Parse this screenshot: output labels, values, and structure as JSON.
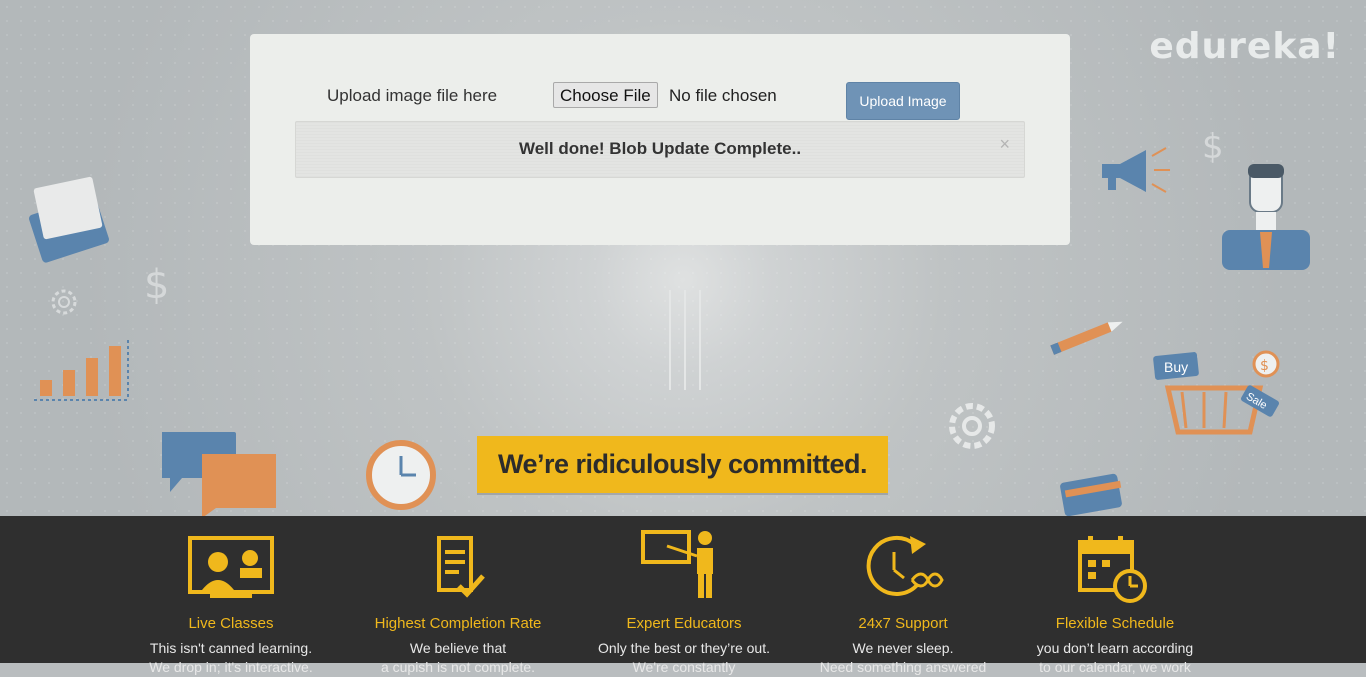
{
  "brand": "edureka!",
  "upload": {
    "label": "Upload image file here",
    "choose_button": "Choose File",
    "file_status": "No file chosen",
    "submit_button": "Upload Image"
  },
  "alert": {
    "message": "Well done! Blob Update Complete..",
    "close": "×"
  },
  "banner": "We’re ridiculously committed.",
  "decor": {
    "buy_tag": "Buy",
    "sale_tag": "Sale",
    "dollar": "$"
  },
  "features": [
    {
      "icon": "live-classes-icon",
      "title": "Live Classes",
      "desc1": "This isn't canned learning.",
      "desc2": "We drop in; it's interactive."
    },
    {
      "icon": "completion-rate-icon",
      "title": "Highest Completion Rate",
      "desc1": "We believe that",
      "desc2": "a cupish is not complete."
    },
    {
      "icon": "expert-educators-icon",
      "title": "Expert Educators",
      "desc1": "Only the best or they’re out.",
      "desc2": "We're constantly"
    },
    {
      "icon": "support-icon",
      "title": "24x7 Support",
      "desc1": "We never sleep.",
      "desc2": "Need something answered"
    },
    {
      "icon": "flexible-schedule-icon",
      "title": "Flexible Schedule",
      "desc1": "you don’t learn according",
      "desc2": "to our calendar, we work"
    }
  ],
  "colors": {
    "accent": "#f0b81c",
    "button": "#6f93b6",
    "footer": "#2f2f2f",
    "illustration_orange": "#e09155",
    "illustration_blue": "#5a84ad"
  }
}
